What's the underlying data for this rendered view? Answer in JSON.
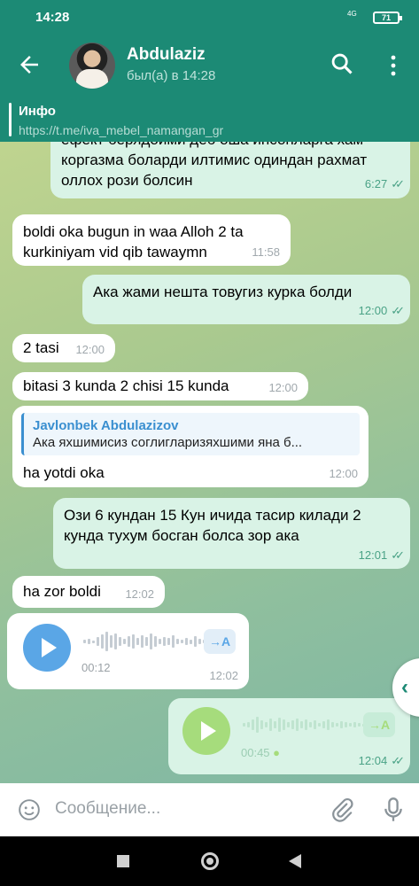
{
  "status_bar": {
    "time": "14:28",
    "signal": "4G",
    "battery": "71"
  },
  "header": {
    "name": "Abdulaziz",
    "last_seen": "был(а) в 14:28",
    "actions": [
      "back-arrow-icon",
      "search-icon",
      "more-vert-icon"
    ]
  },
  "pinned": {
    "title": "Инфо",
    "text": "https://t.me/iva_mebel_namangan_gr"
  },
  "messages": [
    {
      "dir": "out",
      "text": "ефект берядоими дёб оша инсонларга хам коргазма боларди илтимис одиндан рахмат оллох рози болсин",
      "time": "6:27"
    },
    {
      "dir": "in",
      "text": "boldi oka bugun in waa Alloh 2 ta kurkiniyam vid qib tawaymn",
      "time": "11:58"
    },
    {
      "dir": "out",
      "text": "Ака жами нешта товугиз курка болди",
      "time": "12:00"
    },
    {
      "dir": "in",
      "text": "2 tasi",
      "time": "12:00"
    },
    {
      "dir": "in",
      "text": "bitasi 3 kunda 2 chisi 15 kunda",
      "time": "12:00"
    },
    {
      "dir": "in",
      "reply_name": "Javlonbek Abdulazizov",
      "reply_text": "Ака яхшимисиз соглигларизяхшими яна б...",
      "text": "ha yotdi oka",
      "time": "12:00"
    },
    {
      "dir": "out",
      "text": "Ози 6 кундан 15 Кун ичида тасир килади 2 кунда тухум босган болса зор ака",
      "time": "12:01"
    },
    {
      "dir": "in",
      "text": "ha zor boldi",
      "time": "12:02"
    },
    {
      "dir": "in",
      "voice": true,
      "duration": "00:12",
      "transcribe": "→A",
      "time": "12:02"
    },
    {
      "dir": "out",
      "voice": true,
      "duration": "00:45",
      "transcribe": "→A",
      "time": "12:04"
    }
  ],
  "input": {
    "placeholder": "Сообщение..."
  },
  "colors": {
    "header": "#1c8a75",
    "incoming_bubble": "#ffffff",
    "outgoing_bubble": "#d9f3e6",
    "meta_out": "#4aa286",
    "voice_in": "#5aa6e6",
    "voice_out": "#a6dc7c"
  }
}
